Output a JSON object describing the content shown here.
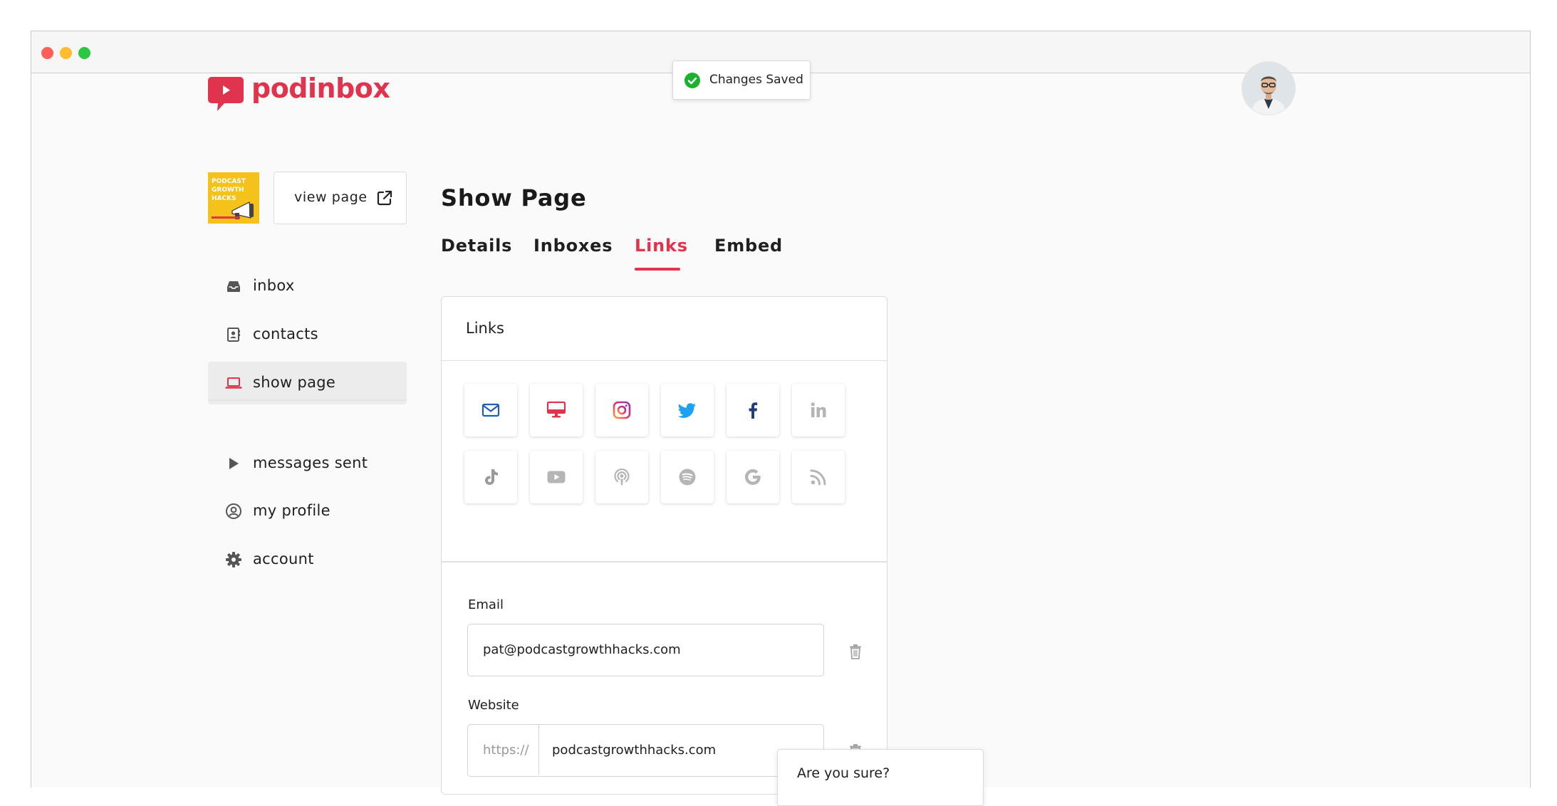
{
  "brand": {
    "name": "podinbox",
    "color": "#e0344e"
  },
  "toast": {
    "text": "Changes Saved",
    "icon": "check-circle-icon",
    "color": "#1ab12e"
  },
  "user": {
    "avatar": "user-avatar"
  },
  "show": {
    "thumbnail_text": "PODCAST\nGROWTH\nHACKS",
    "view_page_label": "view page"
  },
  "sidebar": {
    "items": [
      {
        "label": "inbox",
        "icon": "inbox-icon"
      },
      {
        "label": "contacts",
        "icon": "contacts-icon"
      },
      {
        "label": "show page",
        "icon": "laptop-icon",
        "active": true
      },
      {
        "label": "messages sent",
        "icon": "play-icon"
      },
      {
        "label": "my profile",
        "icon": "user-circle-icon"
      },
      {
        "label": "account",
        "icon": "gear-icon"
      }
    ]
  },
  "main": {
    "title": "Show Page",
    "tabs": [
      {
        "label": "Details"
      },
      {
        "label": "Inboxes"
      },
      {
        "label": "Links",
        "active": true
      },
      {
        "label": "Embed"
      }
    ]
  },
  "links_card": {
    "title": "Links",
    "socials": [
      {
        "name": "email",
        "icon": "envelope-icon",
        "active": true,
        "color": "#1d5fbf"
      },
      {
        "name": "website",
        "icon": "desktop-icon",
        "active": true,
        "color": "#e0344e"
      },
      {
        "name": "instagram",
        "icon": "instagram-icon",
        "active": true,
        "color": "#c13584"
      },
      {
        "name": "twitter",
        "icon": "twitter-icon",
        "active": true,
        "color": "#1da1f2"
      },
      {
        "name": "facebook",
        "icon": "facebook-icon",
        "active": true,
        "color": "#1d3d7a"
      },
      {
        "name": "linkedin",
        "icon": "linkedin-icon",
        "active": false,
        "color": "#b5b5b5"
      },
      {
        "name": "tiktok",
        "icon": "tiktok-icon",
        "active": false,
        "color": "#9a9a9a"
      },
      {
        "name": "youtube",
        "icon": "youtube-icon",
        "active": false,
        "color": "#b5b5b5"
      },
      {
        "name": "apple-podcasts",
        "icon": "podcast-icon",
        "active": false,
        "color": "#b5b5b5"
      },
      {
        "name": "spotify",
        "icon": "spotify-icon",
        "active": false,
        "color": "#b5b5b5"
      },
      {
        "name": "google",
        "icon": "google-icon",
        "active": false,
        "color": "#b5b5b5"
      },
      {
        "name": "rss",
        "icon": "rss-icon",
        "active": false,
        "color": "#b5b5b5"
      }
    ],
    "fields": {
      "email": {
        "label": "Email",
        "value": "pat@podcastgrowthhacks.com"
      },
      "website": {
        "label": "Website",
        "prefix": "https://",
        "value": "podcastgrowthhacks.com"
      }
    }
  },
  "confirm_popover": {
    "text": "Are you sure?"
  }
}
